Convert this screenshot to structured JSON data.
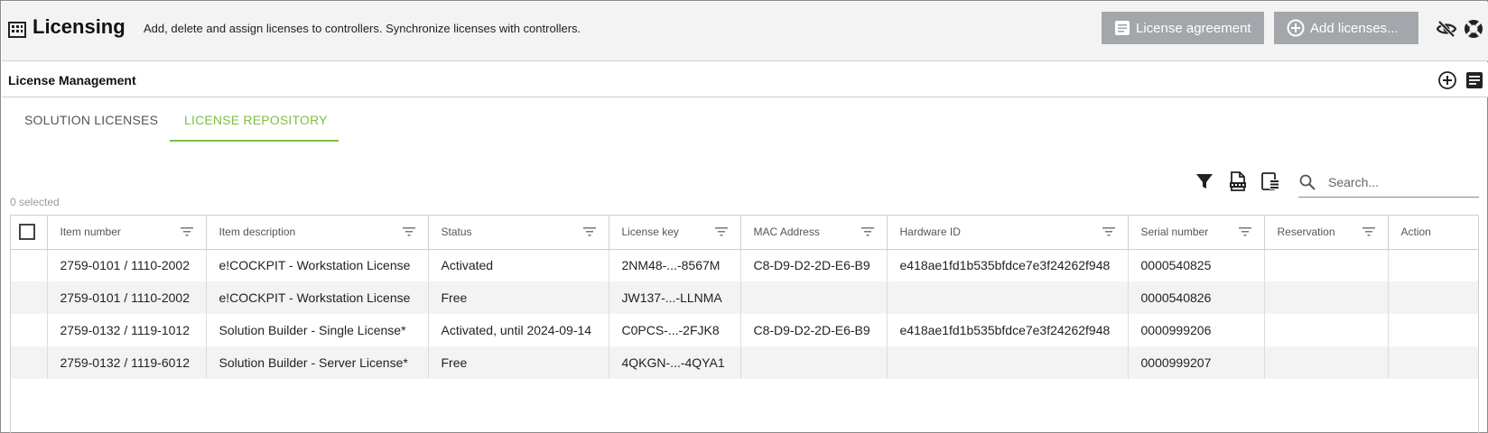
{
  "header": {
    "title": "Licensing",
    "subtitle": "Add, delete and assign licenses to controllers. Synchronize licenses with controllers.",
    "btn_agreement": "License agreement",
    "btn_add": "Add licenses...",
    "icons": [
      "building-icon",
      "document-icon",
      "plus-circle-icon",
      "eye-off-icon",
      "lifebuoy-icon"
    ]
  },
  "section": {
    "title": "License Management"
  },
  "tabs": [
    {
      "label": "SOLUTION LICENSES",
      "active": false
    },
    {
      "label": "LICENSE REPOSITORY",
      "active": true
    }
  ],
  "toolbar": {
    "search_placeholder": "Search...",
    "selected_count": "0 selected"
  },
  "table": {
    "columns": [
      "Item number",
      "Item description",
      "Status",
      "License key",
      "MAC Address",
      "Hardware ID",
      "Serial number",
      "Reservation",
      "Action"
    ],
    "rows": [
      [
        "2759-0101 / 1110-2002",
        "e!COCKPIT - Workstation License",
        "Activated",
        "2NM48-...-8567M",
        "C8-D9-D2-2D-E6-B9",
        "e418ae1fd1b535bfdce7e3f24262f948",
        "0000540825",
        "",
        ""
      ],
      [
        "2759-0101 / 1110-2002",
        "e!COCKPIT - Workstation License",
        "Free",
        "JW137-...-LLNMA",
        "",
        "",
        "0000540826",
        "",
        ""
      ],
      [
        "2759-0132 / 1119-1012",
        "Solution Builder - Single License*",
        "Activated, until 2024-09-14",
        "C0PCS-...-2FJK8",
        "C8-D9-D2-2D-E6-B9",
        "e418ae1fd1b535bfdce7e3f24262f948",
        "0000999206",
        "",
        ""
      ],
      [
        "2759-0132 / 1119-6012",
        "Solution Builder - Server License*",
        "Free",
        "4QKGN-...-4QYA1",
        "",
        "",
        "0000999207",
        "",
        ""
      ]
    ]
  },
  "colors": {
    "accent": "#7bc143",
    "header_bg": "#f3f3f3",
    "button_bg": "#a3a6aa",
    "row_alt": "#f3f3f3"
  }
}
